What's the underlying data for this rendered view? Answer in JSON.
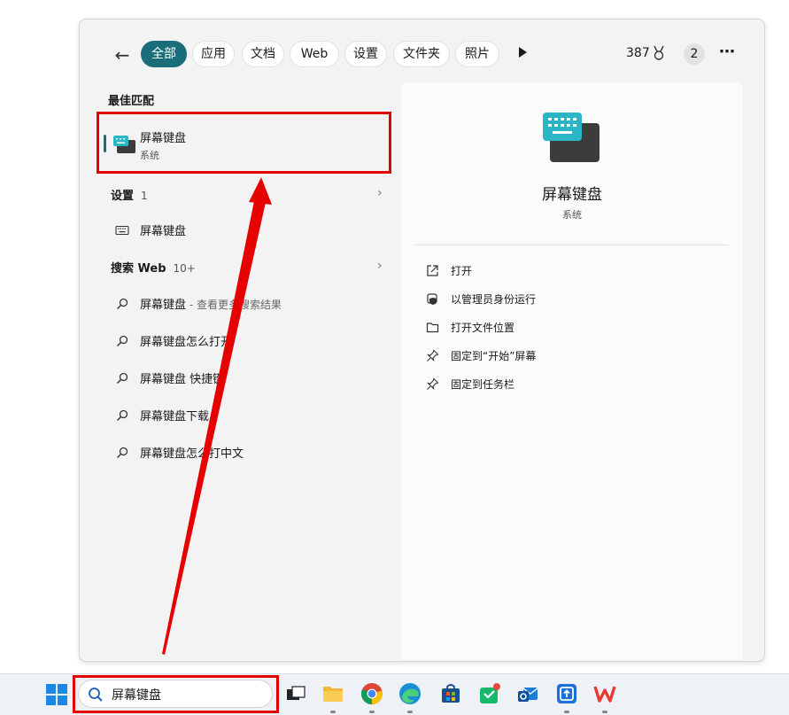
{
  "topbar": {
    "chips": [
      {
        "label": "全部",
        "active": true
      },
      {
        "label": "应用",
        "active": false
      },
      {
        "label": "文档",
        "active": false
      },
      {
        "label": "Web",
        "active": false
      },
      {
        "label": "设置",
        "active": false
      },
      {
        "label": "文件夹",
        "active": false
      },
      {
        "label": "照片",
        "active": false
      }
    ],
    "points": "387",
    "count": "2"
  },
  "best_match": {
    "header": "最佳匹配",
    "title": "屏幕键盘",
    "subtitle": "系统"
  },
  "settings_group": {
    "header": "设置",
    "count": "1",
    "items": [
      "屏幕键盘"
    ]
  },
  "web_group": {
    "header": "搜索 Web",
    "count": "10+",
    "items": [
      {
        "text": "屏幕键盘",
        "suffix": " - 查看更多搜索结果"
      },
      {
        "text": "屏幕键盘怎么打开",
        "suffix": ""
      },
      {
        "text": "屏幕键盘 快捷键",
        "suffix": ""
      },
      {
        "text": "屏幕键盘下载",
        "suffix": ""
      },
      {
        "text": "屏幕键盘怎么打中文",
        "suffix": ""
      }
    ]
  },
  "detail": {
    "title": "屏幕键盘",
    "subtitle": "系统",
    "actions": [
      "打开",
      "以管理员身份运行",
      "打开文件位置",
      "固定到“开始”屏幕",
      "固定到任务栏"
    ]
  },
  "taskbar": {
    "search_text": "屏幕键盘"
  },
  "colors": {
    "accent": "#1a6e7a",
    "highlight": "#e30000"
  }
}
